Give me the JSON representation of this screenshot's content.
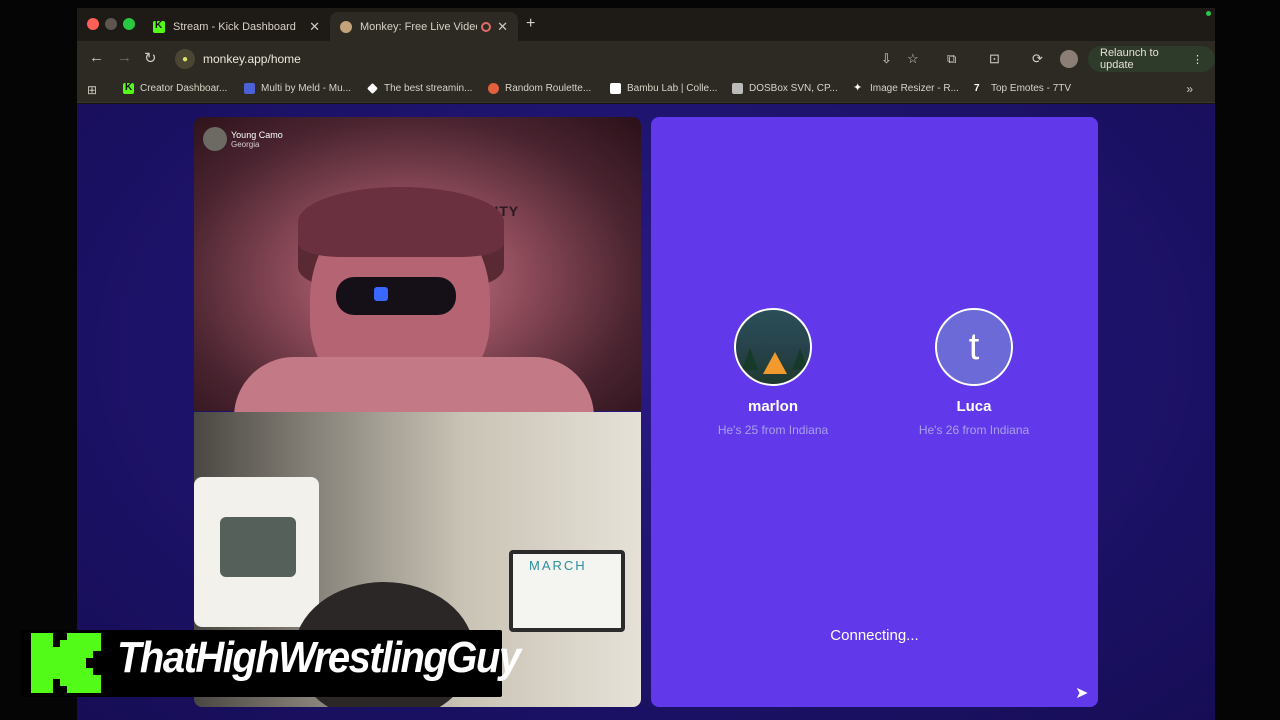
{
  "tabs": [
    {
      "title": "Stream - Kick Dashboard",
      "favicon": "kick-icon",
      "active": false
    },
    {
      "title": "Monkey: Free Live Video Chat",
      "favicon": "monkey-icon",
      "active": true
    }
  ],
  "toolbar": {
    "url": "monkey.app/home",
    "relaunch_label": "Relaunch to update"
  },
  "bookmarks": [
    {
      "label": "Creator Dashboar...",
      "icon": "kick-icon"
    },
    {
      "label": "Multi by Meld - Mu...",
      "icon": "meld-icon"
    },
    {
      "label": "The best streamin...",
      "icon": "diamond-icon"
    },
    {
      "label": "Random Roulette...",
      "icon": "roulette-icon"
    },
    {
      "label": "Bambu Lab | Colle...",
      "icon": "bambu-icon"
    },
    {
      "label": "DOSBox SVN, CP...",
      "icon": "dosbox-icon"
    },
    {
      "label": "Image Resizer - R...",
      "icon": "sparkle-icon"
    },
    {
      "label": "Top Emotes - 7TV",
      "icon": "7tv-icon"
    }
  ],
  "video": {
    "remote_user_name": "Young Camo",
    "remote_user_location": "Georgia",
    "poster_text": "CALL·DUTY",
    "whiteboard_text": "MARCH"
  },
  "overlay": {
    "streamer_name": "ThatHighWrestlingGuy",
    "brand_color": "#53fc18"
  },
  "match": {
    "people": [
      {
        "name": "marlon",
        "description": "He's 25 from Indiana",
        "avatar": "campfire-avatar"
      },
      {
        "name": "Luca",
        "description": "He's 26 from Indiana",
        "avatar_letter": "t"
      }
    ],
    "status": "Connecting...",
    "panel_color": "#6239ea"
  }
}
